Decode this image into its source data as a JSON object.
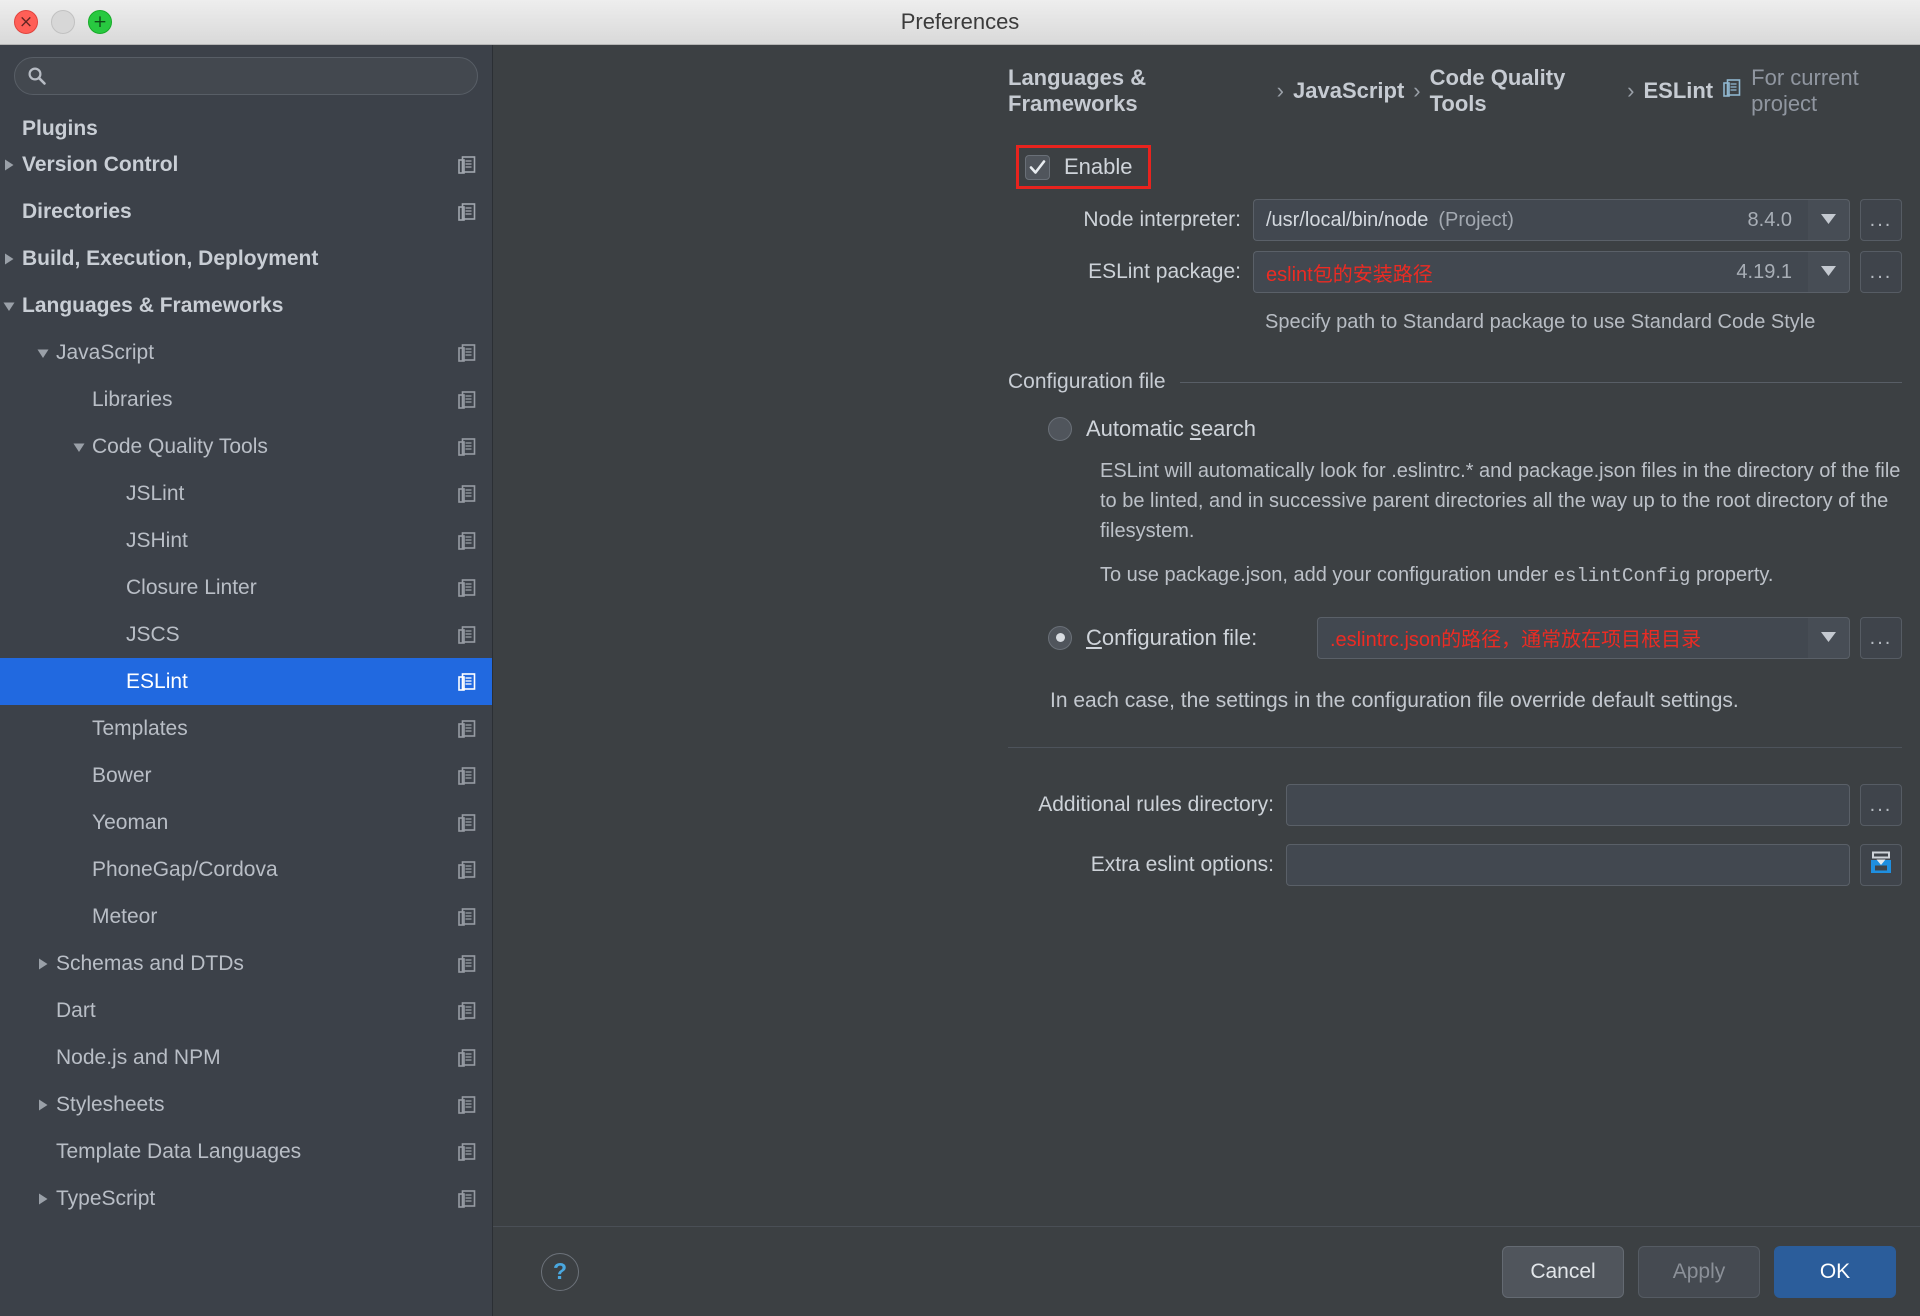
{
  "window": {
    "title": "Preferences",
    "traffic": {
      "close": "×",
      "minimize": "",
      "zoom": "+"
    }
  },
  "sidebar": {
    "search": {
      "placeholder": "",
      "value": "",
      "icon": "search-icon"
    },
    "items": [
      {
        "label": "Plugins",
        "level": 0,
        "arrow": "none",
        "bold": true,
        "copy": false,
        "selected": false,
        "clipped": true
      },
      {
        "label": "Version Control",
        "level": 0,
        "arrow": "collapsed",
        "bold": true,
        "copy": true,
        "selected": false
      },
      {
        "label": "Directories",
        "level": 0,
        "arrow": "none",
        "bold": true,
        "copy": true,
        "selected": false
      },
      {
        "label": "Build, Execution, Deployment",
        "level": 0,
        "arrow": "collapsed",
        "bold": true,
        "copy": false,
        "selected": false
      },
      {
        "label": "Languages & Frameworks",
        "level": 0,
        "arrow": "expanded",
        "bold": true,
        "copy": false,
        "selected": false
      },
      {
        "label": "JavaScript",
        "level": 1,
        "arrow": "expanded",
        "bold": false,
        "copy": true,
        "selected": false
      },
      {
        "label": "Libraries",
        "level": 2,
        "arrow": "none",
        "bold": false,
        "copy": true,
        "selected": false
      },
      {
        "label": "Code Quality Tools",
        "level": 2,
        "arrow": "expanded",
        "bold": false,
        "copy": true,
        "selected": false
      },
      {
        "label": "JSLint",
        "level": 3,
        "arrow": "none",
        "bold": false,
        "copy": true,
        "selected": false
      },
      {
        "label": "JSHint",
        "level": 3,
        "arrow": "none",
        "bold": false,
        "copy": true,
        "selected": false
      },
      {
        "label": "Closure Linter",
        "level": 3,
        "arrow": "none",
        "bold": false,
        "copy": true,
        "selected": false
      },
      {
        "label": "JSCS",
        "level": 3,
        "arrow": "none",
        "bold": false,
        "copy": true,
        "selected": false
      },
      {
        "label": "ESLint",
        "level": 3,
        "arrow": "none",
        "bold": false,
        "copy": true,
        "selected": true
      },
      {
        "label": "Templates",
        "level": 2,
        "arrow": "none",
        "bold": false,
        "copy": true,
        "selected": false
      },
      {
        "label": "Bower",
        "level": 2,
        "arrow": "none",
        "bold": false,
        "copy": true,
        "selected": false
      },
      {
        "label": "Yeoman",
        "level": 2,
        "arrow": "none",
        "bold": false,
        "copy": true,
        "selected": false
      },
      {
        "label": "PhoneGap/Cordova",
        "level": 2,
        "arrow": "none",
        "bold": false,
        "copy": true,
        "selected": false
      },
      {
        "label": "Meteor",
        "level": 2,
        "arrow": "none",
        "bold": false,
        "copy": true,
        "selected": false
      },
      {
        "label": "Schemas and DTDs",
        "level": 1,
        "arrow": "collapsed",
        "bold": false,
        "copy": true,
        "selected": false
      },
      {
        "label": "Dart",
        "level": 1,
        "arrow": "none",
        "bold": false,
        "copy": true,
        "selected": false
      },
      {
        "label": "Node.js and NPM",
        "level": 1,
        "arrow": "none",
        "bold": false,
        "copy": true,
        "selected": false
      },
      {
        "label": "Stylesheets",
        "level": 1,
        "arrow": "collapsed",
        "bold": false,
        "copy": true,
        "selected": false
      },
      {
        "label": "Template Data Languages",
        "level": 1,
        "arrow": "none",
        "bold": false,
        "copy": true,
        "selected": false
      },
      {
        "label": "TypeScript",
        "level": 1,
        "arrow": "collapsed",
        "bold": false,
        "copy": true,
        "selected": false
      }
    ]
  },
  "breadcrumb": {
    "parts": [
      "Languages & Frameworks",
      "JavaScript",
      "Code Quality Tools",
      "ESLint"
    ],
    "separator": "›",
    "scope_note": "For current project",
    "scope_icon": "project-scope-icon"
  },
  "eslint": {
    "enable": {
      "label": "Enable",
      "checked": true,
      "annotated": true
    },
    "node_interpreter": {
      "label": "Node interpreter:",
      "value": "/usr/local/bin/node",
      "suffix": "(Project)",
      "version": "8.4.0",
      "dropdown_icon": "chevron-down-icon",
      "browse_label": "..."
    },
    "eslint_package": {
      "label": "ESLint package:",
      "value": "eslint包的安装路径",
      "value_color": "#ec2b23",
      "version": "4.19.1",
      "dropdown_icon": "chevron-down-icon",
      "browse_label": "..."
    },
    "package_hint": "Specify path to Standard package to use Standard Code Style",
    "config_group": {
      "title": "Configuration file",
      "automatic": {
        "label": "Automatic search",
        "underline_char": "s",
        "selected": false,
        "paragraph1": "ESLint will automatically look for .eslintrc.* and package.json files in the directory of the file to be linted, and in successive parent directories all the way up to the root directory of the filesystem.",
        "paragraph2_pre": "To use package.json, add your configuration under ",
        "paragraph2_mono": "eslintConfig",
        "paragraph2_post": " property."
      },
      "configuration_file": {
        "label": "Configuration file:",
        "underline_char": "C",
        "selected": true,
        "value": ".eslintrc.json的路径，通常放在项目根目录",
        "value_color": "#ec2b23",
        "dropdown_icon": "chevron-down-icon",
        "browse_label": "..."
      },
      "override_note": "In each case, the settings in the configuration file override default settings."
    },
    "additional_rules_directory": {
      "label": "Additional rules directory:",
      "value": "",
      "browse_label": "..."
    },
    "extra_eslint_options": {
      "label": "Extra eslint options:",
      "value": "",
      "expand_icon": "insert-expand-icon"
    }
  },
  "footer": {
    "help_label": "?",
    "cancel": "Cancel",
    "apply": "Apply",
    "ok": "OK",
    "apply_disabled": true
  },
  "colors": {
    "accent_selection": "#2169e0",
    "annotation_red": "#e8231e",
    "primary_button": "#2b5d9b",
    "background": "#3c4043",
    "sidebar_background": "#3c4149"
  }
}
